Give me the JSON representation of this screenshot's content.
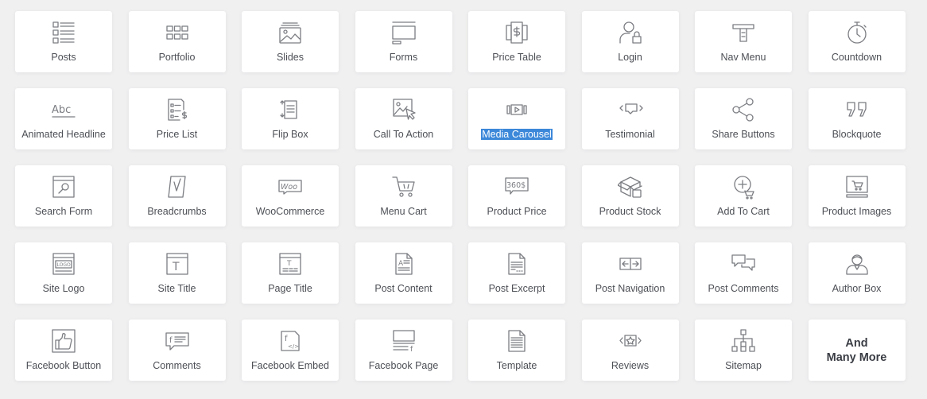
{
  "widgets": [
    {
      "label": "Posts",
      "icon": "posts-icon"
    },
    {
      "label": "Portfolio",
      "icon": "portfolio-icon"
    },
    {
      "label": "Slides",
      "icon": "slides-icon"
    },
    {
      "label": "Forms",
      "icon": "forms-icon"
    },
    {
      "label": "Price Table",
      "icon": "price-table-icon"
    },
    {
      "label": "Login",
      "icon": "login-icon"
    },
    {
      "label": "Nav Menu",
      "icon": "nav-menu-icon"
    },
    {
      "label": "Countdown",
      "icon": "countdown-icon"
    },
    {
      "label": "Animated Headline",
      "icon": "animated-headline-icon"
    },
    {
      "label": "Price List",
      "icon": "price-list-icon"
    },
    {
      "label": "Flip Box",
      "icon": "flip-box-icon"
    },
    {
      "label": "Call To Action",
      "icon": "call-to-action-icon"
    },
    {
      "label": "Media Carousel",
      "icon": "media-carousel-icon",
      "selected": true
    },
    {
      "label": "Testimonial",
      "icon": "testimonial-icon"
    },
    {
      "label": "Share Buttons",
      "icon": "share-buttons-icon"
    },
    {
      "label": "Blockquote",
      "icon": "blockquote-icon"
    },
    {
      "label": "Search Form",
      "icon": "search-form-icon"
    },
    {
      "label": "Breadcrumbs",
      "icon": "breadcrumbs-icon"
    },
    {
      "label": "WooCommerce",
      "icon": "woocommerce-icon"
    },
    {
      "label": "Menu Cart",
      "icon": "menu-cart-icon"
    },
    {
      "label": "Product Price",
      "icon": "product-price-icon"
    },
    {
      "label": "Product Stock",
      "icon": "product-stock-icon"
    },
    {
      "label": "Add To Cart",
      "icon": "add-to-cart-icon"
    },
    {
      "label": "Product Images",
      "icon": "product-images-icon"
    },
    {
      "label": "Site Logo",
      "icon": "site-logo-icon"
    },
    {
      "label": "Site Title",
      "icon": "site-title-icon"
    },
    {
      "label": "Page Title",
      "icon": "page-title-icon"
    },
    {
      "label": "Post Content",
      "icon": "post-content-icon"
    },
    {
      "label": "Post Excerpt",
      "icon": "post-excerpt-icon"
    },
    {
      "label": "Post Navigation",
      "icon": "post-navigation-icon"
    },
    {
      "label": "Post Comments",
      "icon": "post-comments-icon"
    },
    {
      "label": "Author Box",
      "icon": "author-box-icon"
    },
    {
      "label": "Facebook Button",
      "icon": "facebook-button-icon"
    },
    {
      "label": "Comments",
      "icon": "comments-icon"
    },
    {
      "label": "Facebook Embed",
      "icon": "facebook-embed-icon"
    },
    {
      "label": "Facebook Page",
      "icon": "facebook-page-icon"
    },
    {
      "label": "Template",
      "icon": "template-icon"
    },
    {
      "label": "Reviews",
      "icon": "reviews-icon"
    },
    {
      "label": "Sitemap",
      "icon": "sitemap-icon"
    }
  ],
  "more": {
    "text": "And\nMany More"
  },
  "icon_text": {
    "animated_headline": "Abc",
    "product_price": "360$",
    "woo": "Woo",
    "logo": "LOGO",
    "title_t": "T",
    "content_a": "A",
    "facebook_f": "f",
    "embed_code": "</>"
  },
  "colors": {
    "background": "#f0f0f1",
    "card": "#ffffff",
    "icon": "#7b7d82",
    "label": "#4c4f55",
    "selection": "#3b87d9"
  }
}
